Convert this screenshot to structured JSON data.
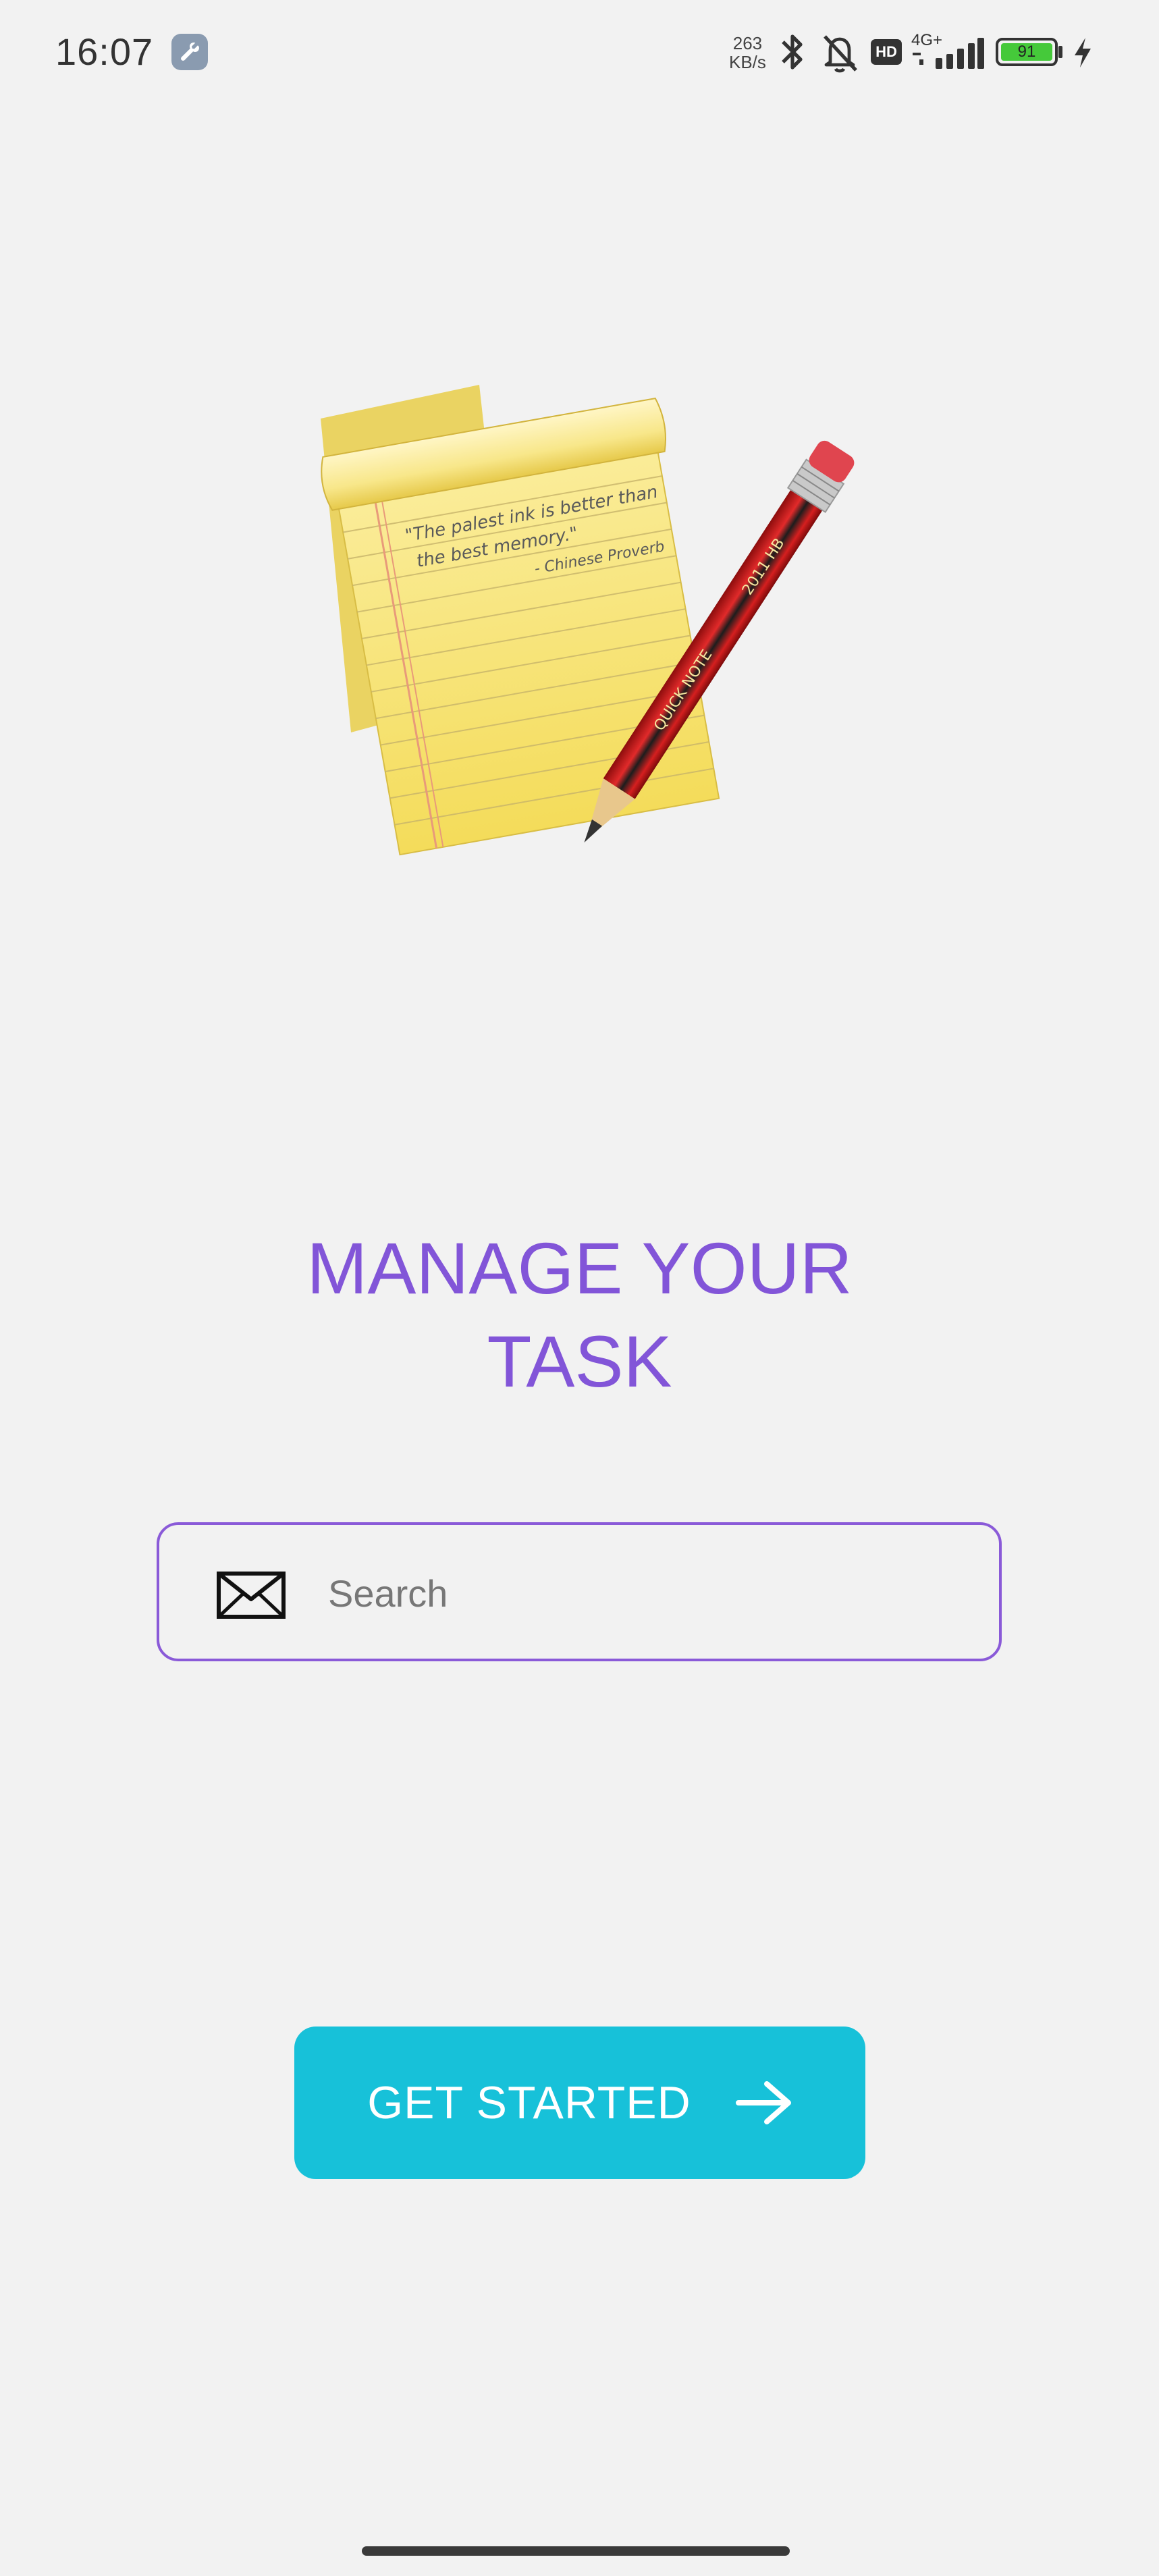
{
  "status_bar": {
    "time": "16:07",
    "net_speed_value": "263",
    "net_speed_unit": "KB/s",
    "hd_label": "HD",
    "network_label": "4G+",
    "battery_level": "91",
    "icons": [
      "wrench-icon",
      "bluetooth-icon",
      "bell-off-icon",
      "signal-icon",
      "charging-icon"
    ]
  },
  "illustration": {
    "note_quote_line1": "\"The palest ink is better than",
    "note_quote_line2": "the best memory.\"",
    "note_attribution": "- Chinese Proverb",
    "pencil_label": "QUICK NOTE",
    "pencil_code": "2011 HB"
  },
  "main": {
    "headline_line1": "MANAGE YOUR",
    "headline_line2": "TASK",
    "search": {
      "placeholder": "Search",
      "value": "",
      "icon": "mail-icon"
    },
    "cta_label": "GET STARTED",
    "cta_icon": "arrow-right-icon"
  },
  "colors": {
    "background": "#f2f2f2",
    "headline": "#8255d8",
    "search_border": "#8a5ad8",
    "cta_background": "#17c1d9",
    "cta_text": "#ffffff"
  }
}
